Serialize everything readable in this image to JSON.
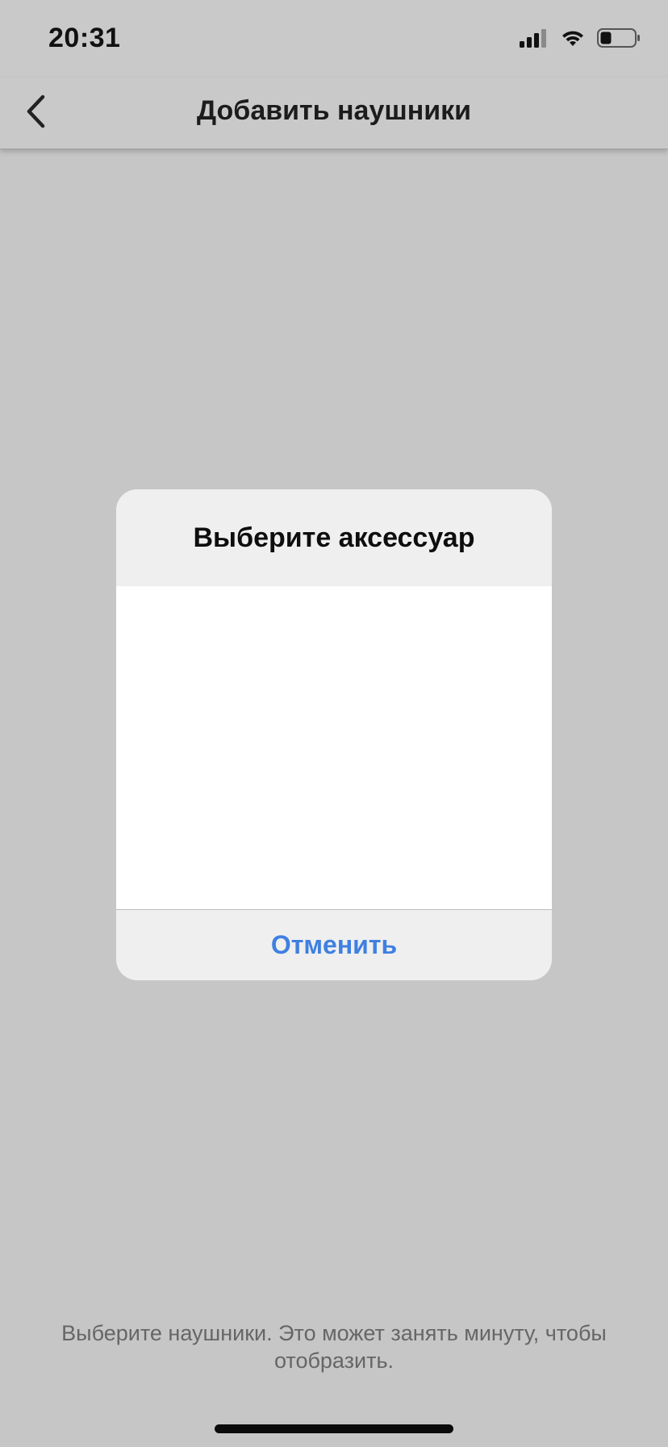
{
  "status_bar": {
    "time": "20:31",
    "icons": [
      "signal-icon",
      "wifi-icon",
      "battery-icon"
    ]
  },
  "nav": {
    "title": "Добавить наушники",
    "back_icon": "chevron-left-icon"
  },
  "dialog": {
    "title": "Выберите аксессуар",
    "items": [],
    "cancel_label": "Отменить"
  },
  "hint": "Выберите наушники. Это может занять минуту, чтобы отобразить.",
  "colors": {
    "background": "#c6c6c6",
    "dialog_header": "#efefef",
    "dialog_list": "#ffffff",
    "accent": "#3f80e0"
  }
}
